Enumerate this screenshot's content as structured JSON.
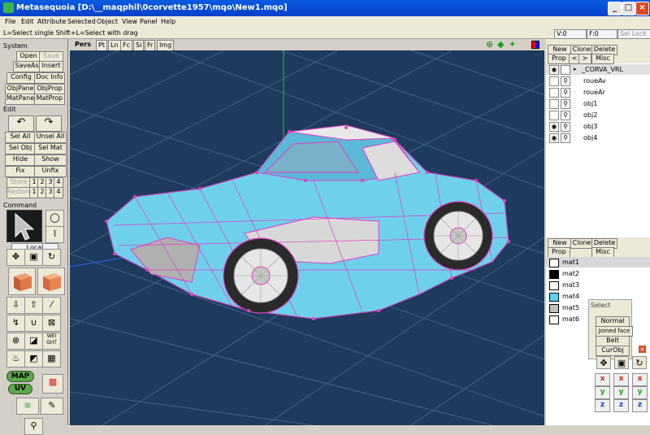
{
  "window": {
    "title": "Metasequoia [D:\\__maqphil\\0corvette1957\\mqo\\New1.mqo]",
    "minimize": "_",
    "maximize": "□",
    "close": "×"
  },
  "menus": [
    "File",
    "Edit",
    "Attribute",
    "Selected",
    "Object",
    "View",
    "Panel",
    "Help"
  ],
  "status": {
    "hint": "L=Select single  Shift+L=Select with drag",
    "vertex": "V:0",
    "face": "F:0",
    "sel_lock": "Sel Lock"
  },
  "left": {
    "system_label": "System",
    "system_buttons": [
      "Open",
      "Save",
      "SaveAs",
      "Insert",
      "Config",
      "Doc Info",
      "ObjPane",
      "ObjProp",
      "MatPane",
      "MatProp"
    ],
    "edit_label": "Edit",
    "edit_buttons": [
      "Sel All",
      "Unsel All",
      "Sel Obj",
      "Sel Mat",
      "Hide",
      "Show",
      "Fix",
      "Unfix",
      "Store",
      "Restore"
    ],
    "num_buttons": [
      "1",
      "2",
      "3",
      "4"
    ],
    "command_label": "Command",
    "local_label": "Local",
    "map_label": "MAP",
    "uv_label": "UV",
    "weight_label": "WEI GHT"
  },
  "viewtabs": [
    "Pers",
    "Pt",
    "Ln",
    "Fc",
    "Si",
    "Fr",
    "Img"
  ],
  "objects": {
    "header_buttons": [
      "New",
      "Clone",
      "Delete",
      "Prop",
      "<",
      ">",
      "Misc"
    ],
    "items": [
      "_CORVA_VRL",
      "roueAv",
      "roueAr",
      "obj1",
      "obj2",
      "obj3",
      "obj4"
    ]
  },
  "materials": {
    "header_buttons": [
      "New",
      "Clone",
      "Delete",
      "Prop",
      "Misc"
    ],
    "items": [
      {
        "name": "mat1",
        "color": "#ffffff"
      },
      {
        "name": "mat2",
        "color": "#000000"
      },
      {
        "name": "mat3",
        "color": "#ffffff"
      },
      {
        "name": "mat4",
        "color": "#5bd3f0"
      },
      {
        "name": "mat5",
        "color": "#c0c0c0"
      },
      {
        "name": "mat6",
        "color": "#ffffff"
      }
    ]
  },
  "select_panel": {
    "title": "Select",
    "options": [
      "Normal",
      "Joined face",
      "Belt",
      "CurObj"
    ]
  },
  "axis_buttons": [
    "x",
    "x",
    "x",
    "y",
    "y",
    "y",
    "z",
    "z",
    "z"
  ],
  "colors": {
    "viewport_bg": "#1e3a5c",
    "car_body": "#6fd0ec",
    "wireframe": "#e040c0",
    "title_bar": "#0a5be0"
  }
}
